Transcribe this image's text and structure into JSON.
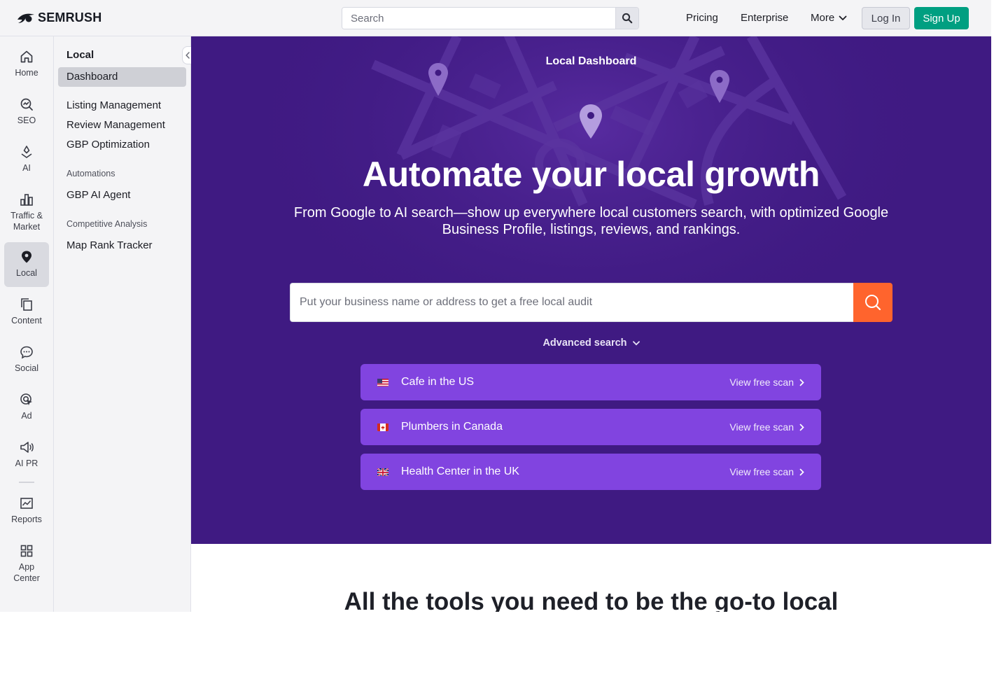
{
  "header": {
    "logo_text": "SEMRUSH",
    "search_placeholder": "Search",
    "nav": {
      "pricing": "Pricing",
      "enterprise": "Enterprise",
      "more": "More"
    },
    "login_label": "Log In",
    "signup_label": "Sign Up",
    "signup_color": "#009f81"
  },
  "iconbar": {
    "items": [
      {
        "label": "Home",
        "icon": "home-icon"
      },
      {
        "label": "SEO",
        "icon": "seo-icon"
      },
      {
        "label": "AI",
        "icon": "ai-icon"
      },
      {
        "label": "Traffic &\nMarket",
        "icon": "traffic-icon"
      },
      {
        "label": "Local",
        "icon": "location-pin-icon",
        "active": true
      },
      {
        "label": "Content",
        "icon": "content-icon"
      },
      {
        "label": "Social",
        "icon": "social-icon"
      },
      {
        "label": "Ad",
        "icon": "ad-icon"
      },
      {
        "label": "AI PR",
        "icon": "megaphone-icon"
      },
      {
        "label": "Reports",
        "icon": "reports-icon"
      },
      {
        "label": "App\nCenter",
        "icon": "app-center-icon"
      }
    ]
  },
  "subnav": {
    "title": "Local",
    "active": "Dashboard",
    "items": [
      "Listing Management",
      "Review Management",
      "GBP Optimization"
    ],
    "sections": [
      {
        "title": "Automations",
        "items": [
          "GBP AI Agent"
        ]
      },
      {
        "title": "Competitive Analysis",
        "items": [
          "Map Rank Tracker"
        ]
      }
    ]
  },
  "hero": {
    "eyebrow": "Local Dashboard",
    "headline": "Automate your local growth",
    "subhead": "From Google to AI search—show up everywhere local customers search, with optimized Google Business Profile, listings, reviews, and rankings.",
    "audit_placeholder": "Put your business name or address to get a free local audit",
    "advanced_search": "Advanced search",
    "background_color": "#3f1a82",
    "accent_color": "#ff642d",
    "scans": [
      {
        "label": "Cafe in the US",
        "cta": "View free scan",
        "flag": "us-flag-icon"
      },
      {
        "label": "Plumbers in Canada",
        "cta": "View free scan",
        "flag": "canada-flag-icon"
      },
      {
        "label": "Health Center in the UK",
        "cta": "View free scan",
        "flag": "uk-flag-icon"
      }
    ]
  },
  "tools_section": {
    "title": "All the tools you need to be the go-to local"
  }
}
